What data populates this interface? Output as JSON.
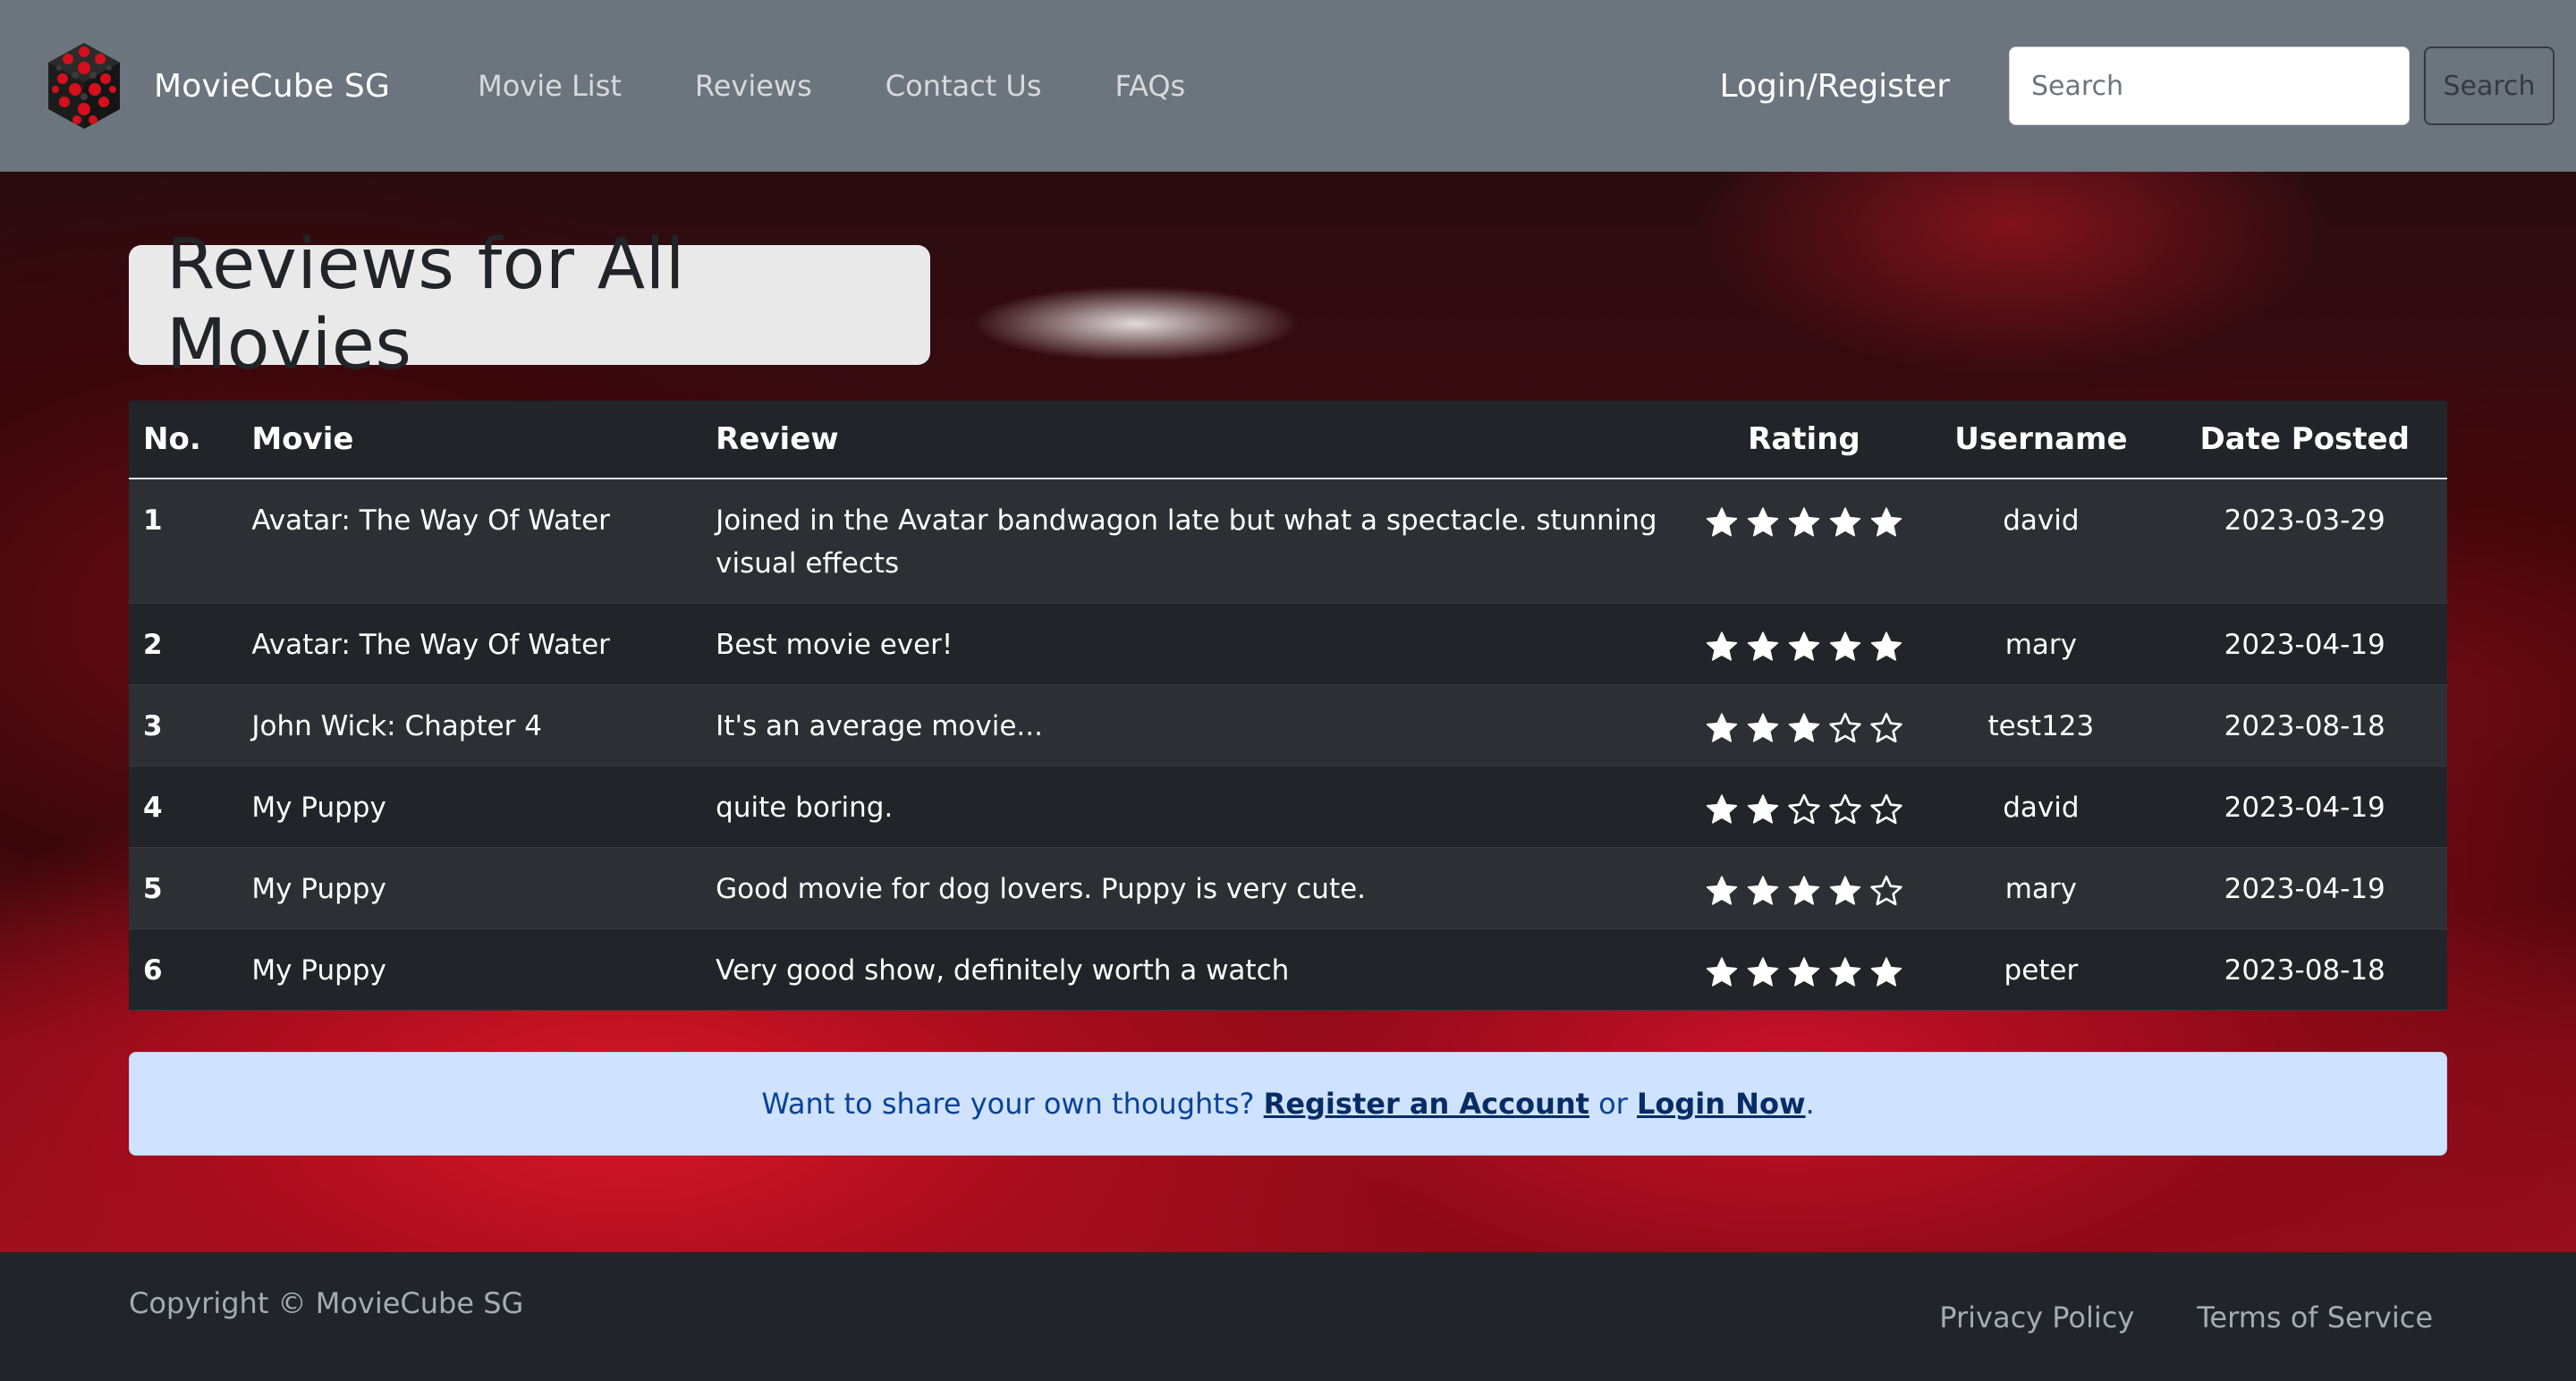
{
  "navbar": {
    "brand": "MovieCube SG",
    "links": [
      "Movie List",
      "Reviews",
      "Contact Us",
      "FAQs"
    ],
    "login": "Login/Register",
    "search_placeholder": "Search",
    "search_button": "Search"
  },
  "page": {
    "title": "Reviews for All Movies"
  },
  "table": {
    "headers": [
      "No.",
      "Movie",
      "Review",
      "Rating",
      "Username",
      "Date Posted"
    ],
    "rows": [
      {
        "no": "1",
        "movie": "Avatar: The Way Of Water",
        "review": "Joined in the Avatar bandwagon late but what a spectacle. stunning visual effects",
        "rating": 5,
        "username": "david",
        "date": "2023-03-29"
      },
      {
        "no": "2",
        "movie": "Avatar: The Way Of Water",
        "review": "Best movie ever!",
        "rating": 5,
        "username": "mary",
        "date": "2023-04-19"
      },
      {
        "no": "3",
        "movie": "John Wick: Chapter 4",
        "review": "It's an average movie...",
        "rating": 3,
        "username": "test123",
        "date": "2023-08-18"
      },
      {
        "no": "4",
        "movie": "My Puppy",
        "review": "quite boring.",
        "rating": 2,
        "username": "david",
        "date": "2023-04-19"
      },
      {
        "no": "5",
        "movie": "My Puppy",
        "review": "Good movie for dog lovers. Puppy is very cute.",
        "rating": 4,
        "username": "mary",
        "date": "2023-04-19"
      },
      {
        "no": "6",
        "movie": "My Puppy",
        "review": "Very good show, definitely worth a watch",
        "rating": 5,
        "username": "peter",
        "date": "2023-08-18"
      }
    ],
    "max_rating": 5
  },
  "alert": {
    "text_before": "Want to share your own thoughts? ",
    "register_link": "Register an Account",
    "middle": " or ",
    "login_link": "Login Now",
    "after": "."
  },
  "footer": {
    "copyright": "Copyright © MovieCube SG",
    "links": [
      "Privacy Policy",
      "Terms of Service"
    ]
  },
  "colors": {
    "navbar_bg": "#6c757d",
    "table_bg": "#212529",
    "alert_bg": "#cfe2ff",
    "alert_link": "#052c65"
  },
  "icons": {
    "logo": "cube-logo-icon",
    "star_filled": "star-filled-icon",
    "star_empty": "star-outline-icon"
  }
}
